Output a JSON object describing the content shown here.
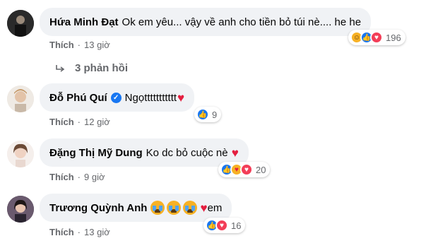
{
  "comments": [
    {
      "author": "Hứa Minh Đạt",
      "text": "Ok em yêu... vậy về anh cho tiền bỏ túi nè.... he he",
      "reaction_count": "196",
      "reactions": [
        "haha-icon",
        "like-icon",
        "love-icon"
      ],
      "like_label": "Thích",
      "time": "13 giờ"
    },
    {
      "author": "Đỗ Phú Quí",
      "text": "Ngọttttttttttt",
      "reaction_count": "9",
      "reactions": [
        "like-icon"
      ],
      "like_label": "Thích",
      "time": "12 giờ"
    },
    {
      "author": "Đặng Thị Mỹ Dung",
      "text": "Ko dc bỏ cuộc nè",
      "reaction_count": "20",
      "reactions": [
        "like-icon",
        "care-icon",
        "love-icon"
      ],
      "like_label": "Thích",
      "time": "9 giờ"
    },
    {
      "author": "Trương Quỳnh Anh",
      "text": "em",
      "reaction_count": "16",
      "reactions": [
        "like-icon",
        "love-icon"
      ],
      "like_label": "Thích",
      "time": "13 giờ"
    }
  ],
  "replies_label": "3 phản hồi",
  "colors": {
    "like_blue": "#1877f2",
    "heart_red": "#e41e3f",
    "bubble_bg": "#f0f2f5",
    "meta_gray": "#65676b"
  }
}
